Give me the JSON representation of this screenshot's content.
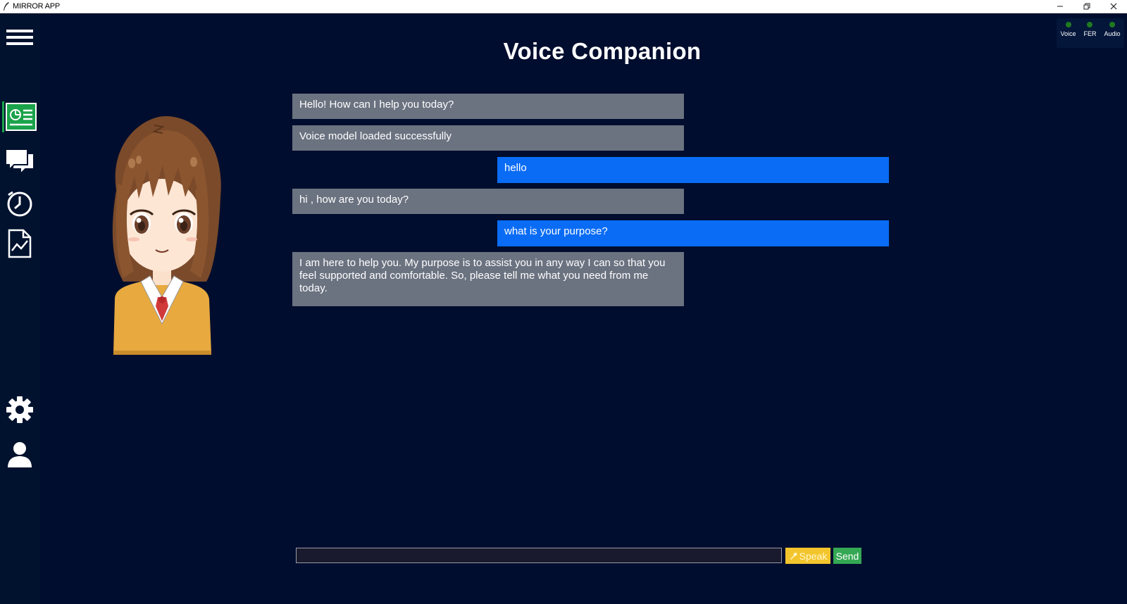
{
  "window": {
    "title": "MIRROR APP"
  },
  "header": {
    "title": "Voice Companion"
  },
  "status": [
    {
      "label": "Voice",
      "color": "#1f7a1f"
    },
    {
      "label": "FER",
      "color": "#1f7a1f"
    },
    {
      "label": "Audio",
      "color": "#1f7a1f"
    }
  ],
  "sidebar": {
    "items": [
      {
        "icon": "menu-icon"
      },
      {
        "icon": "dashboard-icon",
        "active": true
      },
      {
        "icon": "chat-icon"
      },
      {
        "icon": "history-clock-icon"
      },
      {
        "icon": "report-chart-icon"
      },
      {
        "icon": "settings-gear-icon"
      },
      {
        "icon": "user-profile-icon"
      }
    ]
  },
  "messages": [
    {
      "role": "bot",
      "text": "Hello! How can I help you today?"
    },
    {
      "role": "bot",
      "text": "Voice model loaded successfully"
    },
    {
      "role": "user",
      "text": "hello"
    },
    {
      "role": "bot",
      "text": "hi , how are you today?"
    },
    {
      "role": "user",
      "text": "what is your purpose?"
    },
    {
      "role": "bot",
      "text": "I am here to help you. My purpose is to assist you in any way I can so that you feel supported and comfortable. So, please tell me what you need from me today."
    }
  ],
  "composer": {
    "value": "",
    "placeholder": "",
    "speak_label": "Speak",
    "send_label": "Send"
  },
  "colors": {
    "background": "#000d2e",
    "sidebar": "#00122e",
    "bot_bubble": "#6b7280",
    "user_bubble": "#0a6cf5",
    "speak": "#f3c52d",
    "send": "#34a853"
  }
}
